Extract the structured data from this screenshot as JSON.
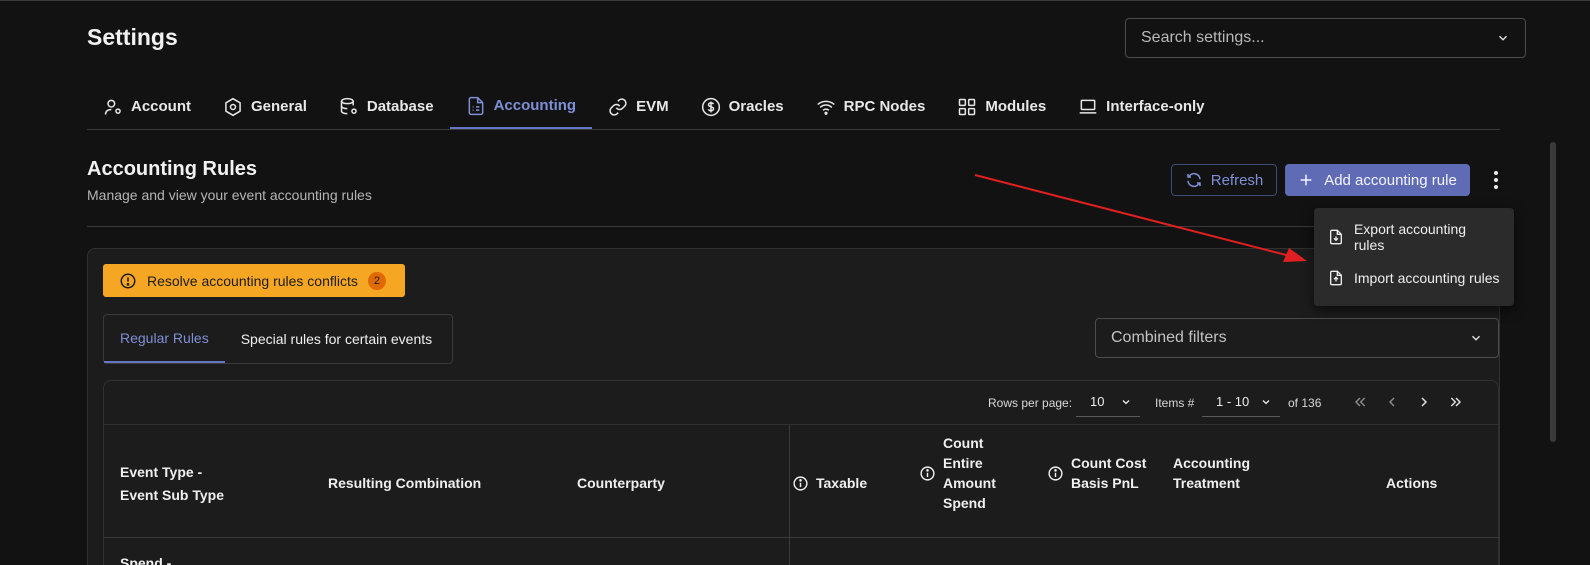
{
  "header": {
    "title": "Settings"
  },
  "search": {
    "placeholder": "Search settings..."
  },
  "tabs": [
    {
      "label": "Account",
      "icon": "user-gear-icon"
    },
    {
      "label": "General",
      "icon": "hexagon-gear-icon"
    },
    {
      "label": "Database",
      "icon": "database-gear-icon"
    },
    {
      "label": "Accounting",
      "icon": "file-list-icon",
      "active": true
    },
    {
      "label": "EVM",
      "icon": "link-icon"
    },
    {
      "label": "Oracles",
      "icon": "dollar-circle-icon"
    },
    {
      "label": "RPC Nodes",
      "icon": "wifi-icon"
    },
    {
      "label": "Modules",
      "icon": "grid-icon"
    },
    {
      "label": "Interface-only",
      "icon": "laptop-icon"
    }
  ],
  "section": {
    "title": "Accounting Rules",
    "subtitle": "Manage and view your event accounting rules"
  },
  "toolbar": {
    "refresh_label": "Refresh",
    "add_label": "Add accounting rule"
  },
  "menu": {
    "export_label": "Export accounting rules",
    "import_label": "Import accounting rules"
  },
  "conflicts": {
    "label": "Resolve accounting rules conflicts",
    "count": "2"
  },
  "subtabs": {
    "regular": "Regular Rules",
    "special": "Special rules for certain events"
  },
  "filter": {
    "label": "Combined filters"
  },
  "pager": {
    "rows_label": "Rows per page:",
    "rows_value": "10",
    "items_label": "Items #",
    "items_value": "1 - 10",
    "total": "of 136"
  },
  "table": {
    "headers": {
      "event_type_1": "Event Type -",
      "event_type_2": "Event Sub Type",
      "resulting": "Resulting Combination",
      "counterparty": "Counterparty",
      "taxable": "Taxable",
      "count_entire_1": "Count",
      "count_entire_2": "Entire",
      "count_entire_3": "Amount",
      "count_entire_4": "Spend",
      "count_cost_1": "Count Cost",
      "count_cost_2": "Basis PnL",
      "treatment_1": "Accounting",
      "treatment_2": "Treatment",
      "actions": "Actions"
    },
    "first_row_text": "Spend -"
  },
  "colors": {
    "accent": "#6674c4",
    "warning": "#f5a623",
    "annotation_arrow": "#e02020"
  }
}
